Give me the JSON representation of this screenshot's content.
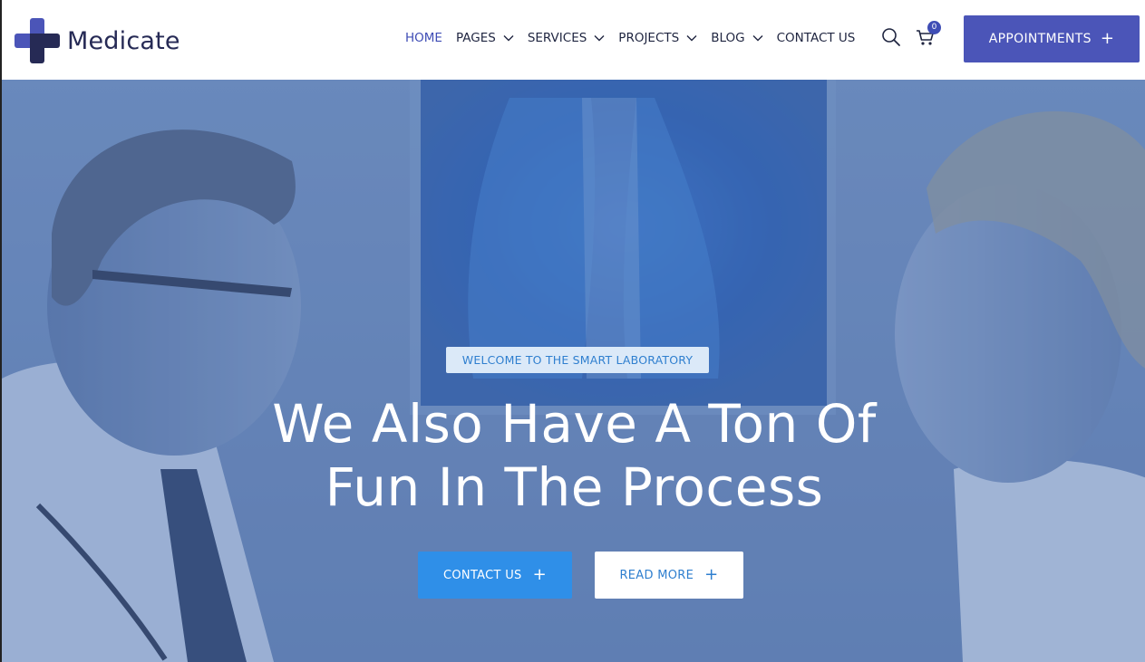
{
  "brand": {
    "name": "Medicate",
    "colors": {
      "primary": "#4b55b8",
      "navy": "#262a55",
      "accent": "#2f8fe8"
    }
  },
  "nav": {
    "items": [
      {
        "label": "HOME",
        "active": true,
        "dropdown": false
      },
      {
        "label": "PAGES",
        "active": false,
        "dropdown": true
      },
      {
        "label": "SERVICES",
        "active": false,
        "dropdown": true
      },
      {
        "label": "PROJECTS",
        "active": false,
        "dropdown": true
      },
      {
        "label": "BLOG",
        "active": false,
        "dropdown": true
      },
      {
        "label": "CONTACT US",
        "active": false,
        "dropdown": false
      }
    ]
  },
  "header_tools": {
    "search_icon": "search-icon",
    "cart_icon": "cart-icon",
    "cart_count": "0",
    "appointments_label": "APPOINTMENTS",
    "appointments_icon": "+"
  },
  "hero": {
    "eyebrow": "WELCOME TO THE SMART LABORATORY",
    "headline_line1": "We Also Have A Ton Of",
    "headline_line2": "Fun In The Process",
    "buttons": {
      "contact_label": "CONTACT US",
      "contact_icon": "+",
      "read_more_label": "READ MORE",
      "read_more_icon": "+"
    }
  }
}
